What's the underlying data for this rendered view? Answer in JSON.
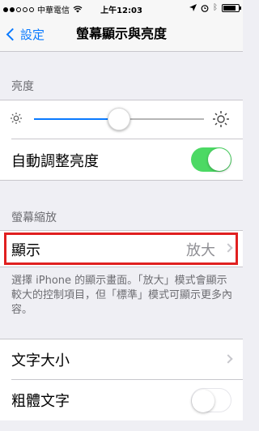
{
  "status_bar": {
    "carrier": "中華電信",
    "time": "上午12:03",
    "battery_level": 0.85
  },
  "nav": {
    "back_label": "設定",
    "title": "螢幕顯示與亮度"
  },
  "brightness": {
    "header": "亮度",
    "slider_value": 0.5,
    "auto_label": "自動調整亮度",
    "auto_on": true
  },
  "zoom": {
    "header": "螢幕縮放",
    "view_label": "顯示",
    "view_value": "放大",
    "footer": "選擇 iPhone 的顯示畫面。「放大」模式會顯示較大的控制項目，但「標準」模式可顯示更多內容。"
  },
  "text": {
    "text_size_label": "文字大小",
    "bold_text_label": "粗體文字",
    "bold_on": false
  },
  "colors": {
    "accent": "#0a7aff",
    "toggle_on": "#4cd964",
    "highlight": "#e02020"
  }
}
